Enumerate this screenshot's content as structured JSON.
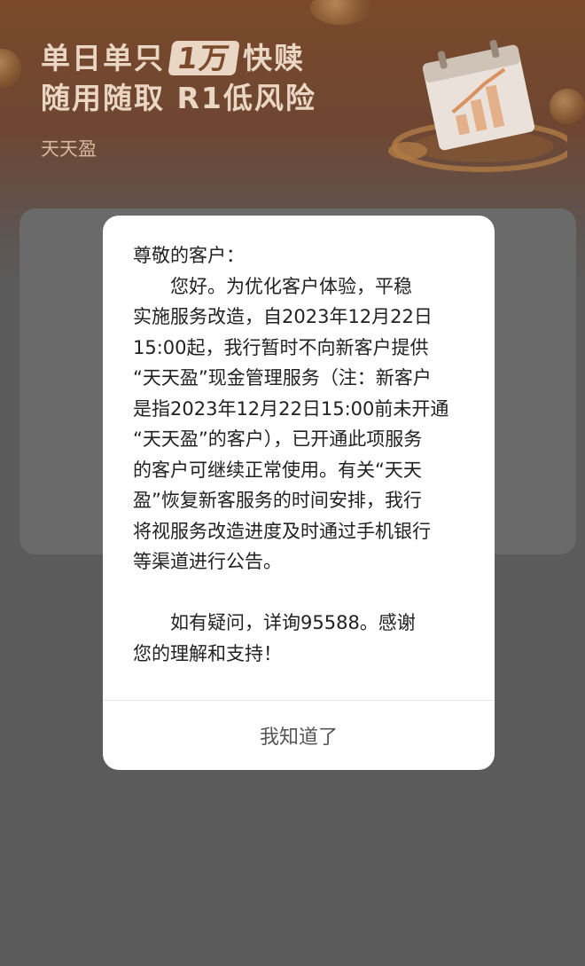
{
  "banner": {
    "line1_before": "单日单只",
    "line1_badge": "1万",
    "line1_after": "快赎",
    "line2": "随用随取 R1低风险",
    "product_name": "天天盈"
  },
  "dialog": {
    "body": "尊敬的客户：\n　　您好。为优化客户体验，平稳\n实施服务改造，自2023年12月22日\n15:00起，我行暂时不向新客户提供\n“天天盈”现金管理服务（注：新客户\n是指2023年12月22日15:00前未开通\n“天天盈”的客户），已开通此项服务\n的客户可继续正常使用。有关“天天\n盈”恢复新客服务的时间安排，我行\n将视服务改造进度及时通过手机银行\n等渠道进行公告。\n\n　　如有疑问，详询95588。感谢\n您的理解和支持！",
    "confirm_label": "我知道了"
  },
  "icons": {
    "calendar": "calendar-chart-icon",
    "coins": "coin-icon"
  },
  "colors": {
    "banner_brown": "#7a4a2a",
    "overlay_gray": "#5b5b5b",
    "dialog_bg": "#ffffff"
  }
}
